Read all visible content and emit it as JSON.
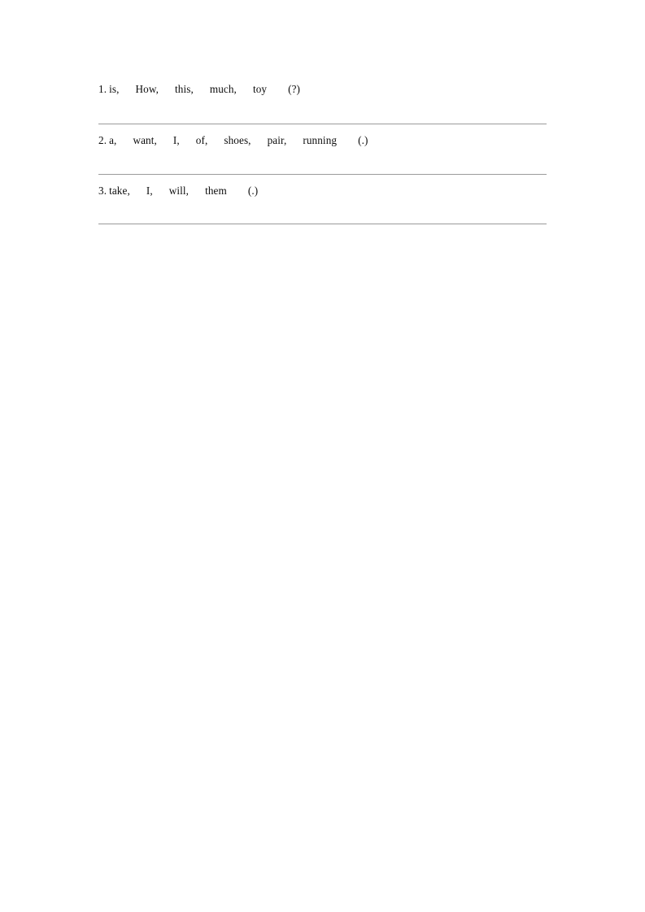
{
  "document": {
    "background_color": "#ffffff",
    "text_color": "#0d0d0d",
    "rule_color": "#9a9a9a"
  },
  "exercises": [
    {
      "number": "1.",
      "tokens": [
        "is,",
        "How,",
        "this,",
        "much,",
        "toy"
      ],
      "punctuation": "(?)",
      "answer_value": "",
      "answer_placeholder": ""
    },
    {
      "number": "2.",
      "tokens": [
        "a,",
        "want,",
        "I,",
        "of,",
        "shoes,",
        "pair,",
        "running"
      ],
      "punctuation": "(.)",
      "answer_value": "",
      "answer_placeholder": ""
    },
    {
      "number": "3.",
      "tokens": [
        "take,",
        "I,",
        "will,",
        "them"
      ],
      "punctuation": "(.)",
      "answer_value": "",
      "answer_placeholder": ""
    }
  ]
}
